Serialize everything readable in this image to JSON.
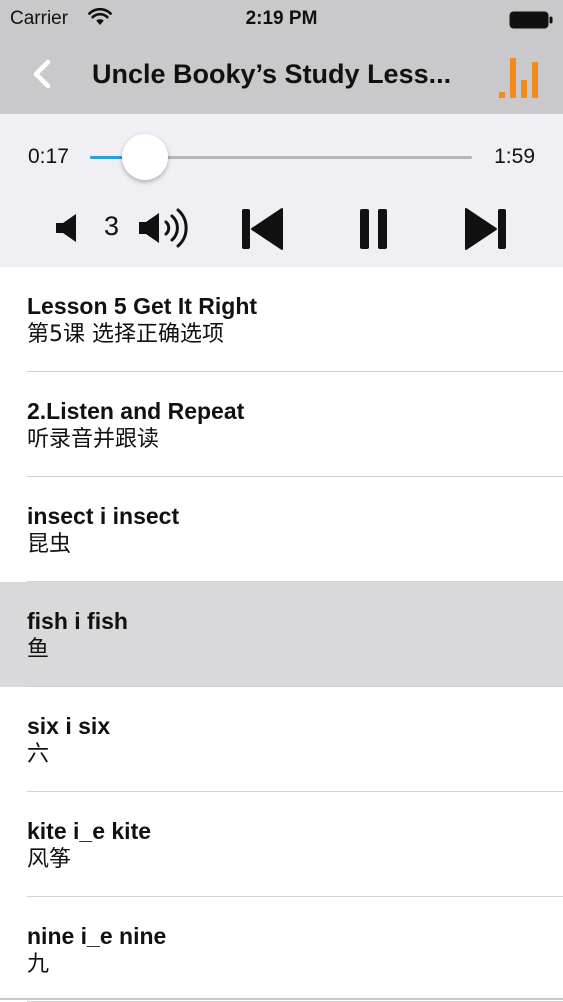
{
  "status_bar": {
    "carrier": "Carrier",
    "time": "2:19 PM"
  },
  "nav": {
    "title": "Uncle Booky’s Study Less...",
    "accent_color": "#f28a1c"
  },
  "player": {
    "elapsed": "0:17",
    "duration": "1:59",
    "progress_fraction": 0.143,
    "volume_level": "3",
    "progress_color": "#2a9fd8"
  },
  "tracks": [
    {
      "title": "Lesson 5 Get It Right",
      "subtitle": "第5课 选择正确选项",
      "selected": false
    },
    {
      "title": "2.Listen and Repeat",
      "subtitle": "听录音并跟读",
      "selected": false
    },
    {
      "title": "insect i insect",
      "subtitle": "昆虫",
      "selected": false
    },
    {
      "title": "fish i fish",
      "subtitle": "鱼",
      "selected": true
    },
    {
      "title": "six i six",
      "subtitle": "六",
      "selected": false
    },
    {
      "title": "kite i_e kite",
      "subtitle": "风筝",
      "selected": false
    },
    {
      "title": "nine i_e nine",
      "subtitle": "九",
      "selected": false
    }
  ],
  "icons": {
    "wifi": "wifi-icon",
    "battery": "battery-icon",
    "back": "chevron-left-icon",
    "equalizer": "equalizer-icon",
    "volume_down": "speaker-low-icon",
    "volume_up": "speaker-high-icon",
    "previous": "skip-previous-icon",
    "pause": "pause-icon",
    "next": "skip-next-icon"
  }
}
